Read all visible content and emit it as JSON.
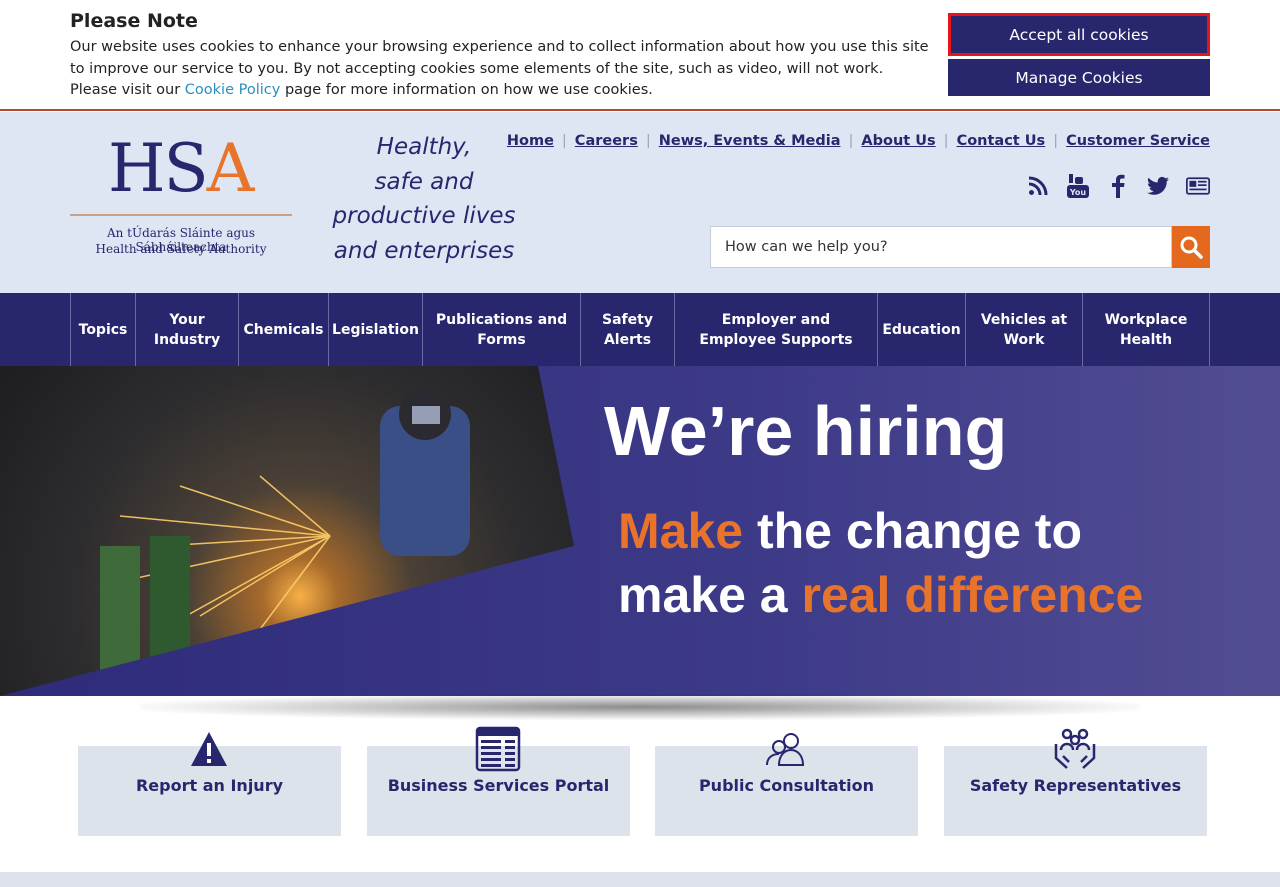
{
  "cookie": {
    "title": "Please Note",
    "text_before_link": "Our website uses cookies to enhance your browsing experience and to collect information about how you use this site to improve our service to you. By not accepting cookies some elements of the site, such as video, will not work. Please visit our ",
    "link_text": "Cookie Policy",
    "text_after_link": " page for more information on how we use cookies.",
    "accept_label": "Accept all cookies",
    "manage_label": "Manage Cookies"
  },
  "logo": {
    "letters_hs": "HS",
    "letter_a": "A",
    "irish_name": "An tÚdarás Sláinte agus Sábháilteachta",
    "english_name": "Health and Safety Authority"
  },
  "tagline": [
    "Healthy,",
    "safe and",
    "productive lives",
    "and enterprises"
  ],
  "top_links": [
    "Home",
    "Careers",
    "News, Events & Media",
    "About Us",
    "Contact Us",
    "Customer Service"
  ],
  "social_icons": [
    "rss-icon",
    "youtube-icon",
    "facebook-icon",
    "twitter-icon",
    "newsletter-icon"
  ],
  "search": {
    "placeholder": "How can we help you?"
  },
  "nav": [
    "Topics",
    "Your Industry",
    "Chemicals",
    "Legislation",
    "Publications and Forms",
    "Safety Alerts",
    "Employer and Employee Supports",
    "Education",
    "Vehicles at Work",
    "Workplace Health"
  ],
  "hero": {
    "headline": "We’re hiring",
    "line2_orange": "Make",
    "line2_white": " the change to",
    "line3_white": "make a ",
    "line3_orange": "real difference"
  },
  "quick_links": [
    {
      "label": "Report an Injury",
      "icon": "warning-icon"
    },
    {
      "label": "Business Services Portal",
      "icon": "portal-icon"
    },
    {
      "label": "Public Consultation",
      "icon": "people-icon"
    },
    {
      "label": "Safety Representatives",
      "icon": "group-hands-icon"
    }
  ],
  "colors": {
    "navy": "#28276e",
    "orange": "#e8732a",
    "header_bg": "#dfe6f3",
    "tile_bg": "#dde3ea"
  }
}
